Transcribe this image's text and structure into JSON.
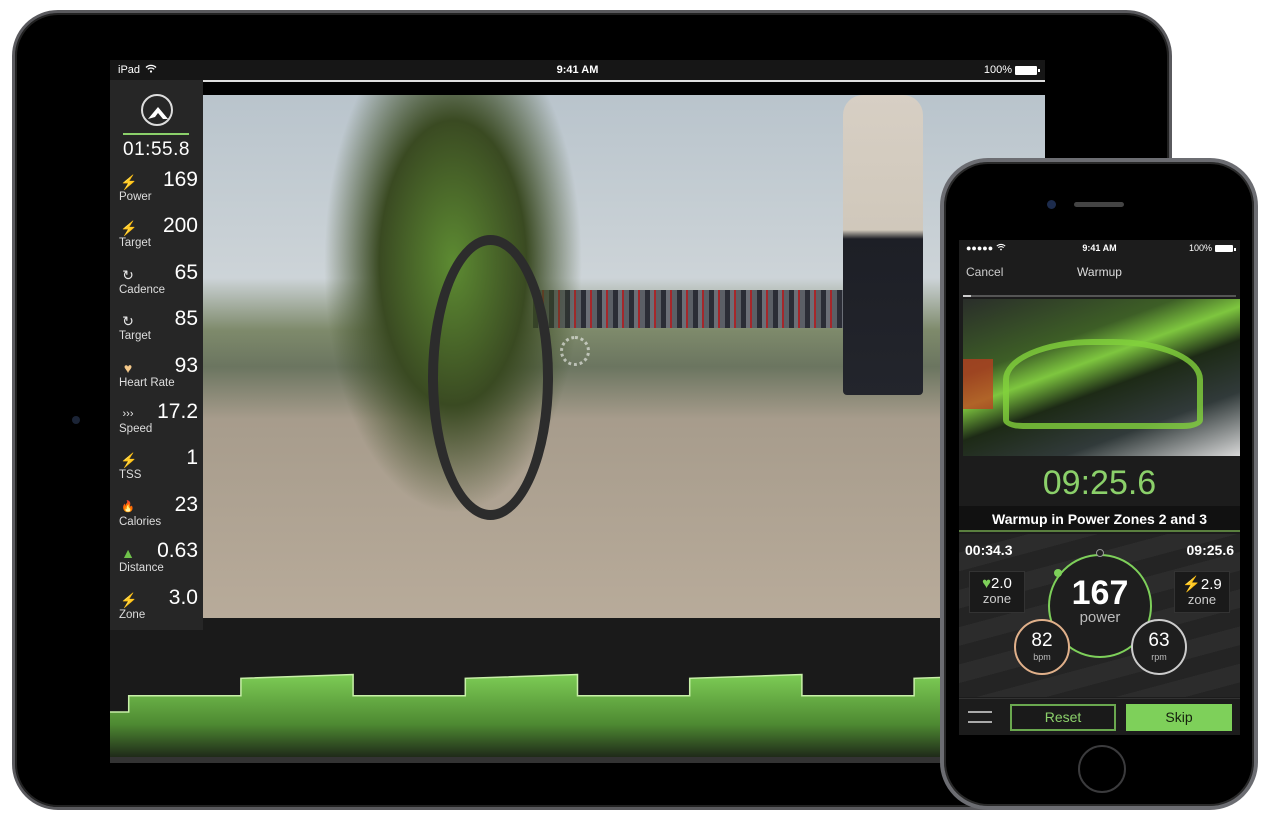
{
  "ipad": {
    "status": {
      "device": "iPad",
      "time": "9:41 AM",
      "battery": "100%"
    },
    "sidebar": {
      "elapsed": "01:55.8",
      "metrics": [
        {
          "icon": "lightning-icon",
          "glyph": "⚡",
          "value": "169",
          "label": "Power",
          "color": "#f0e3a0"
        },
        {
          "icon": "lightning-icon",
          "glyph": "⚡",
          "value": "200",
          "label": "Target",
          "color": "#f0e3a0"
        },
        {
          "icon": "cadence-icon",
          "glyph": "↻",
          "value": "65",
          "label": "Cadence",
          "color": "#e8e8e8"
        },
        {
          "icon": "cadence-icon",
          "glyph": "↻",
          "value": "85",
          "label": "Target",
          "color": "#e8e8e8"
        },
        {
          "icon": "heart-icon",
          "glyph": "♥",
          "value": "93",
          "label": "Heart Rate",
          "color": "#f5c98a"
        },
        {
          "icon": "speed-icon",
          "glyph": "›››",
          "value": "17.2",
          "label": "Speed",
          "color": "#e8e8e8"
        },
        {
          "icon": "lightning-icon",
          "glyph": "⚡",
          "value": "1",
          "label": "TSS",
          "color": "#f0e3a0"
        },
        {
          "icon": "flame-icon",
          "glyph": "🔥",
          "value": "23",
          "label": "Calories",
          "color": "#f0e3a0"
        },
        {
          "icon": "distance-icon",
          "glyph": "▲",
          "value": "0.63",
          "label": "Distance",
          "color": "#6fc24a"
        },
        {
          "icon": "lightning-icon",
          "glyph": "⚡",
          "value": "3.0",
          "label": "Zone",
          "color": "#f0e3a0"
        }
      ]
    },
    "workout_profile": {
      "description": "Target power profile (relative units, 0-1 of chart height)",
      "segments": [
        {
          "start": 0.0,
          "end": 0.02,
          "from": 0.36,
          "to": 0.36
        },
        {
          "start": 0.02,
          "end": 0.14,
          "from": 0.49,
          "to": 0.49
        },
        {
          "start": 0.14,
          "end": 0.26,
          "from": 0.63,
          "to": 0.66
        },
        {
          "start": 0.26,
          "end": 0.38,
          "from": 0.49,
          "to": 0.49
        },
        {
          "start": 0.38,
          "end": 0.5,
          "from": 0.63,
          "to": 0.66
        },
        {
          "start": 0.5,
          "end": 0.62,
          "from": 0.49,
          "to": 0.49
        },
        {
          "start": 0.62,
          "end": 0.74,
          "from": 0.63,
          "to": 0.66
        },
        {
          "start": 0.74,
          "end": 0.86,
          "from": 0.49,
          "to": 0.49
        },
        {
          "start": 0.86,
          "end": 0.98,
          "from": 0.63,
          "to": 0.66
        },
        {
          "start": 0.98,
          "end": 1.0,
          "from": 0.29,
          "to": 0.29
        }
      ]
    }
  },
  "iphone": {
    "status": {
      "time": "9:41 AM",
      "battery": "100%"
    },
    "nav": {
      "cancel": "Cancel",
      "title": "Warmup"
    },
    "remaining_big": "09:25.6",
    "description": "Warmup in Power Zones 2 and 3",
    "elapsed": "00:34.3",
    "remaining": "09:25.6",
    "hr_zone": {
      "value": "2.0",
      "label": "zone"
    },
    "power_zone": {
      "value": "2.9",
      "label": "zone"
    },
    "power": {
      "value": "167",
      "label": "power"
    },
    "heart_rate": {
      "value": "82",
      "label": "bpm"
    },
    "cadence": {
      "value": "63",
      "label": "rpm"
    },
    "buttons": {
      "reset": "Reset",
      "skip": "Skip"
    },
    "colors": {
      "accent": "#7ed05a",
      "hr": "#e0b08a"
    }
  }
}
